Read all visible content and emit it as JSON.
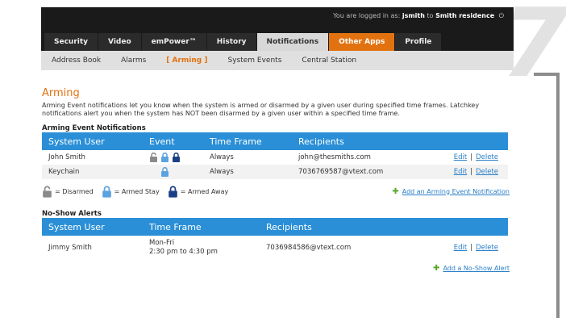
{
  "header": {
    "login_prefix": "You are logged in as:",
    "username": "jsmith",
    "login_mid": "to",
    "residence": "Smith residence",
    "power_glyph": "⏻",
    "page_number": "7"
  },
  "tabs": [
    {
      "label": "Security",
      "state": "normal"
    },
    {
      "label": "Video",
      "state": "normal"
    },
    {
      "label": "emPower™",
      "state": "normal"
    },
    {
      "label": "History",
      "state": "normal"
    },
    {
      "label": "Notifications",
      "state": "active"
    },
    {
      "label": "Other Apps",
      "state": "orange"
    },
    {
      "label": "Profile",
      "state": "normal"
    }
  ],
  "subnav": [
    {
      "label": "Address Book",
      "active": false
    },
    {
      "label": "Alarms",
      "active": false
    },
    {
      "label": "[ Arming ]",
      "active": true
    },
    {
      "label": "System Events",
      "active": false
    },
    {
      "label": "Central Station",
      "active": false
    }
  ],
  "arming": {
    "title": "Arming",
    "description": "Arming Event notifications let you know when the system is armed or disarmed by a given user during specified time frames. Latchkey notifications alert you when the system has NOT been disarmed by a given user within a specified time frame.",
    "section_title": "Arming Event Notifications",
    "columns": [
      "System User",
      "Event",
      "Time Frame",
      "Recipients"
    ],
    "rows": [
      {
        "user": "John Smith",
        "events": [
          "disarmed",
          "armed-stay",
          "armed-away"
        ],
        "time_frame": "Always",
        "recipients": "john@thesmiths.com",
        "edit": "Edit",
        "sep": "|",
        "delete": "Delete"
      },
      {
        "user": "Keychain",
        "events": [
          "armed-stay"
        ],
        "time_frame": "Always",
        "recipients": "7036769587@vtext.com",
        "edit": "Edit",
        "sep": "|",
        "delete": "Delete"
      }
    ],
    "legend": [
      {
        "icon": "disarmed",
        "label": "= Disarmed"
      },
      {
        "icon": "armed-stay",
        "label": "= Armed Stay"
      },
      {
        "icon": "armed-away",
        "label": "= Armed Away"
      }
    ],
    "add_label": "Add an Arming Event Notification"
  },
  "noshow": {
    "section_title": "No-Show Alerts",
    "columns": [
      "System User",
      "Time Frame",
      "Recipients"
    ],
    "rows": [
      {
        "user": "Jimmy Smith",
        "days": "Mon-Fri",
        "hours": "2:30 pm to 4:30 pm",
        "recipients": "7036984586@vtext.com",
        "edit": "Edit",
        "sep": "|",
        "delete": "Delete"
      }
    ],
    "add_label": "Add a No-Show Alert"
  },
  "colors": {
    "accent": "#e2720f",
    "table_header": "#2a8fd6",
    "link": "#2a7fc8",
    "lock_disarmed": "#8a8a8a",
    "lock_stay": "#5ba3df",
    "lock_away": "#1b3f86"
  }
}
